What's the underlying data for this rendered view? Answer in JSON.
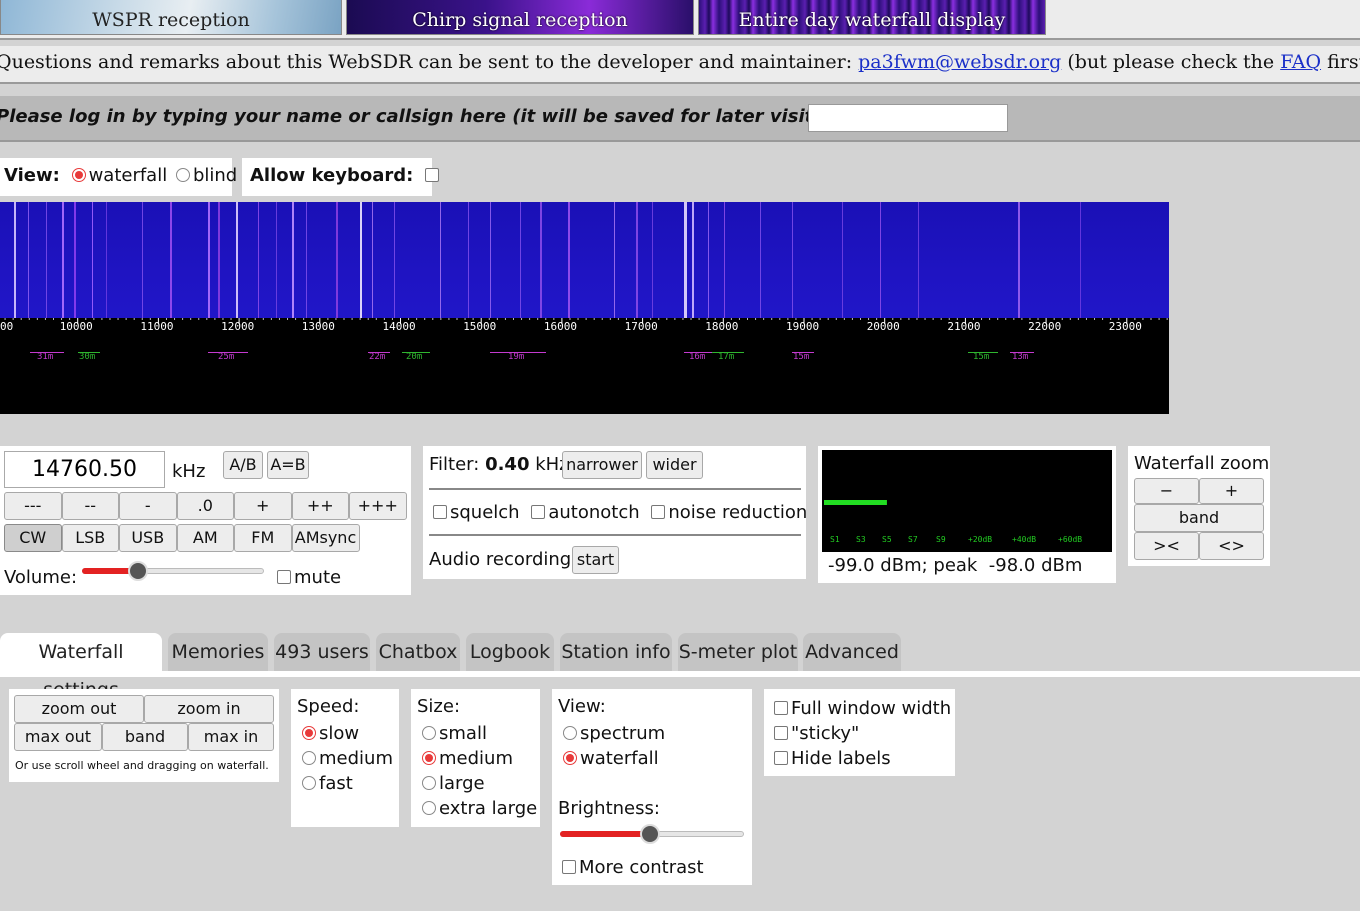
{
  "banner": {
    "thumbs": [
      "WSPR reception",
      "Chirp signal reception",
      "Entire day waterfall display"
    ]
  },
  "contact": {
    "prefix": "Questions and remarks about this WebSDR can be sent to the developer and maintainer: ",
    "email": "pa3fwm@websdr.org",
    "middle": " (but please check the ",
    "faq": "FAQ",
    "suffix": " first)."
  },
  "login": {
    "prompt": "Please log in by typing your name or callsign here (it will be saved for later visits in a cookie):",
    "value": ""
  },
  "view": {
    "label": "View:",
    "waterfall": "waterfall",
    "blind": "blind",
    "selected": "waterfall",
    "allow_keyboard": "Allow keyboard:"
  },
  "scale": {
    "ticks": [
      "00",
      "10000",
      "11000",
      "12000",
      "13000",
      "14000",
      "15000",
      "16000",
      "17000",
      "18000",
      "19000",
      "20000",
      "21000",
      "22000",
      "23000"
    ],
    "bands": [
      {
        "label": "31m",
        "color": "#c43ad0"
      },
      {
        "label": "30m",
        "color": "#2fb62f"
      },
      {
        "label": "25m",
        "color": "#c43ad0"
      },
      {
        "label": "22m",
        "color": "#c43ad0"
      },
      {
        "label": "20m",
        "color": "#2fb62f"
      },
      {
        "label": "19m",
        "color": "#c43ad0"
      },
      {
        "label": "16m",
        "color": "#c43ad0"
      },
      {
        "label": "17m",
        "color": "#2fb62f"
      },
      {
        "label": "15m",
        "color": "#c43ad0"
      },
      {
        "label": "15m",
        "color": "#2fb62f"
      },
      {
        "label": "13m",
        "color": "#c43ad0"
      }
    ],
    "marker_glyph": "⋀"
  },
  "freq": {
    "value": "14760.50",
    "unit": "kHz",
    "ab": "A/B",
    "aeqb": "A=B",
    "steps": [
      "---",
      "--",
      "-",
      ".0",
      "+",
      "++",
      "+++"
    ],
    "modes": [
      "CW",
      "LSB",
      "USB",
      "AM",
      "FM",
      "AMsync"
    ],
    "active_mode": "CW",
    "volume_label": "Volume:",
    "volume_level": 0.31,
    "mute": "mute"
  },
  "filter": {
    "label": "Filter:",
    "value": "0.40",
    "unit": "kHz",
    "narrower": "narrower",
    "wider": "wider",
    "squelch": "squelch",
    "autonotch": "autonotch",
    "noise_reduction": "noise reduction",
    "audio_recording": "Audio recording",
    "start": "start"
  },
  "smeter": {
    "scale": [
      "S1",
      "S3",
      "S5",
      "S7",
      "S9",
      "+20dB",
      "+40dB",
      "+60dB"
    ],
    "reading": "-99.0 dBm; peak  -98.0 dBm",
    "level": 0.22
  },
  "wfzoom": {
    "title": "Waterfall zoom",
    "minus": "−",
    "plus": "+",
    "band": "band",
    "narrow": "><",
    "widen": "<>"
  },
  "tabs": [
    "Waterfall settings",
    "Memories",
    "493 users",
    "Chatbox",
    "Logbook",
    "Station info",
    "S-meter plot",
    "Advanced"
  ],
  "active_tab": "Waterfall settings",
  "wfsettings": {
    "zoom_out": "zoom out",
    "zoom_in": "zoom in",
    "max_out": "max out",
    "band": "band",
    "max_in": "max in",
    "hint": "Or use scroll wheel and dragging on waterfall.",
    "speed_label": "Speed:",
    "speeds": [
      "slow",
      "medium",
      "fast"
    ],
    "speed_selected": "slow",
    "size_label": "Size:",
    "sizes": [
      "small",
      "medium",
      "large",
      "extra large"
    ],
    "size_selected": "medium",
    "view_label": "View:",
    "views": [
      "spectrum",
      "waterfall"
    ],
    "view_selected": "waterfall",
    "brightness_label": "Brightness:",
    "brightness_level": 0.49,
    "more_contrast": "More contrast",
    "full_width": "Full window width",
    "sticky": "\"sticky\"",
    "hide_labels": "Hide labels"
  },
  "colors": {
    "accent": "#e83a3a",
    "link": "#1a2fc8",
    "waterfall_bg": "#1f14c2",
    "smeter_bar": "#22dd22"
  }
}
